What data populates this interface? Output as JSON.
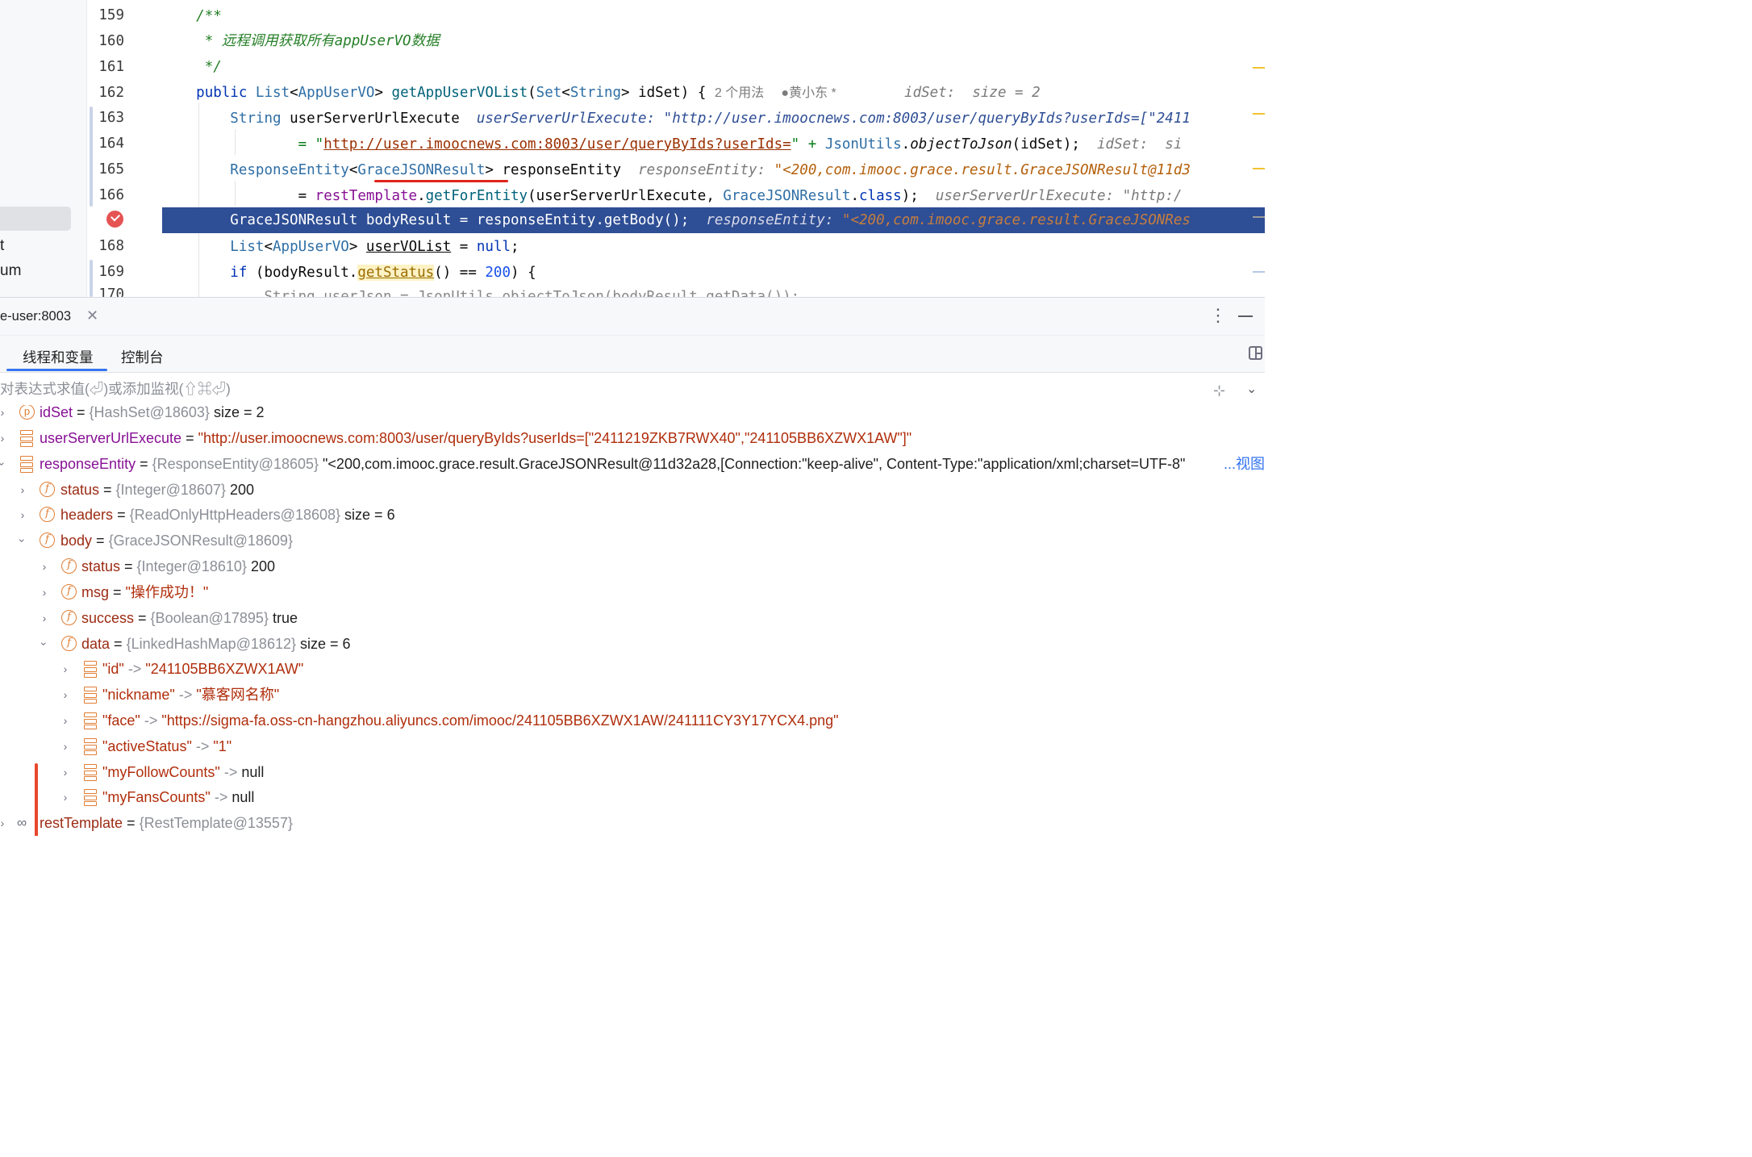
{
  "sidebar": {
    "fragment_1": "t",
    "fragment_2": "um"
  },
  "editor": {
    "line_numbers": [
      "159",
      "160",
      "161",
      "162",
      "163",
      "164",
      "165",
      "166",
      "",
      "168",
      "169",
      "170"
    ],
    "lines": {
      "l159": "/**",
      "l160": " * 远程调用获取所有appUserVO数据",
      "l161": " */",
      "l162_kw": "public",
      "l162_type": "List",
      "l162_gen": "AppUserVO",
      "l162_fn": "getAppUserVOList",
      "l162_ptype1": "Set",
      "l162_ptype2": "String",
      "l162_param": "idSet",
      "l162_usage": "2 个用法",
      "l162_author": "黄小东 *",
      "l162_hint_key": "idSet:",
      "l162_hint_val": "size = 2",
      "l163_type": "String",
      "l163_var": "userServerUrlExecute",
      "l163_hint_key": "userServerUrlExecute:",
      "l163_hint_val": "\"http://user.imoocnews.com:8003/user/queryByIds?userIds=[\"2411",
      "l164_eq": "= \"",
      "l164_url": "http://user.imoocnews.com:8003/user/queryByIds?userIds=",
      "l164_rest_a": "\" + ",
      "l164_cls": "JsonUtils",
      "l164_dot": ".",
      "l164_method": "objectToJson",
      "l164_args": "(idSet);",
      "l164_hint": "idSet:  si",
      "l165_type": "ResponseEntity",
      "l165_gen": "GraceJSONResult",
      "l165_var": "responseEntity",
      "l165_hint_key": "responseEntity:",
      "l165_hint_val": "\"<200,com.imooc.grace.result.GraceJSONResult@11d3",
      "l166_eq": "= ",
      "l166_field": "restTemplate",
      "l166_method": "getForEntity",
      "l166_args1": "(userServerUrlExecute, ",
      "l166_cls": "GraceJSONResult",
      "l166_kw": "class",
      "l166_args2": ");",
      "l166_hint": "userServerUrlExecute: \"http:/",
      "l167_code": "GraceJSONResult bodyResult = responseEntity.getBody();",
      "l167_hint_key": "responseEntity:",
      "l167_hint_val": "\"<200,com.imooc.grace.result.GraceJSONRes",
      "l168_type": "List",
      "l168_gen": "AppUserVO",
      "l168_var": "userVOList",
      "l168_eq": " = ",
      "l168_null": "null",
      "l169_kw": "if",
      "l169_a": " (bodyResult.",
      "l169_method": "getStatus",
      "l169_b": "() == ",
      "l169_num": "200",
      "l169_c": ") {",
      "l170_partial": "String userJson = JsonUtils.objectToJson(bodyResult.getData());"
    }
  },
  "debug": {
    "session_title": "e-user:8003",
    "tabs": [
      "线程和变量",
      "控制台"
    ],
    "eval_placeholder": "对表达式求值(⏎)或添加监视(⇧⌘⏎)",
    "view_link": "...视图",
    "variables": [
      {
        "name": "idSet",
        "type": "{HashSet@18603}",
        "value": "size = 2",
        "icon": "parameter-icon"
      },
      {
        "name": "userServerUrlExecute",
        "type": "",
        "value": "\"http://user.imoocnews.com:8003/user/queryByIds?userIds=[\"2411219ZKB7RWX40\",\"241105BB6XZWX1AW\"]\"",
        "icon": "variable-icon"
      },
      {
        "name": "responseEntity",
        "type": "{ResponseEntity@18605}",
        "value": "\"<200,com.imooc.grace.result.GraceJSONResult@11d32a28,[Connection:\"keep-alive\", Content-Type:\"application/xml;charset=UTF-8\"",
        "icon": "variable-icon"
      },
      {
        "name": "status",
        "type": "{Integer@18607}",
        "value": "200",
        "icon": "field-icon"
      },
      {
        "name": "headers",
        "type": "{ReadOnlyHttpHeaders@18608}",
        "value": "size = 6",
        "icon": "field-icon"
      },
      {
        "name": "body",
        "type": "{GraceJSONResult@18609}",
        "value": "",
        "icon": "field-icon"
      },
      {
        "name": "status",
        "type": "{Integer@18610}",
        "value": "200",
        "icon": "field-icon"
      },
      {
        "name": "msg",
        "type": "",
        "value": "\"操作成功！\"",
        "icon": "field-icon"
      },
      {
        "name": "success",
        "type": "{Boolean@17895}",
        "value": "true",
        "icon": "field-icon"
      },
      {
        "name": "data",
        "type": "{LinkedHashMap@18612}",
        "value": "size = 6",
        "icon": "field-icon"
      },
      {
        "name": "\"id\"",
        "type": "",
        "value": "\"241105BB6XZWX1AW\"",
        "icon": "map-entry-icon"
      },
      {
        "name": "\"nickname\"",
        "type": "",
        "value": "\"慕客网名称\"",
        "icon": "map-entry-icon"
      },
      {
        "name": "\"face\"",
        "type": "",
        "value": "\"https://sigma-fa.oss-cn-hangzhou.aliyuncs.com/imooc/241105BB6XZWX1AW/241111CY3Y17YCX4.png\"",
        "icon": "map-entry-icon"
      },
      {
        "name": "\"activeStatus\"",
        "type": "",
        "value": "\"1\"",
        "icon": "map-entry-icon"
      },
      {
        "name": "\"myFollowCounts\"",
        "type": "",
        "value": "null",
        "icon": "map-entry-icon"
      },
      {
        "name": "\"myFansCounts\"",
        "type": "",
        "value": "null",
        "icon": "map-entry-icon"
      },
      {
        "name": "restTemplate",
        "type": "{RestTemplate@13557}",
        "value": "",
        "icon": "watch-icon"
      }
    ],
    "map_arrow": "->"
  },
  "colors": {
    "exec_line": "#2e4e95",
    "tab_accent": "#3574f0",
    "icon_orange": "#e07e34",
    "map_marker": "#e8472d"
  }
}
